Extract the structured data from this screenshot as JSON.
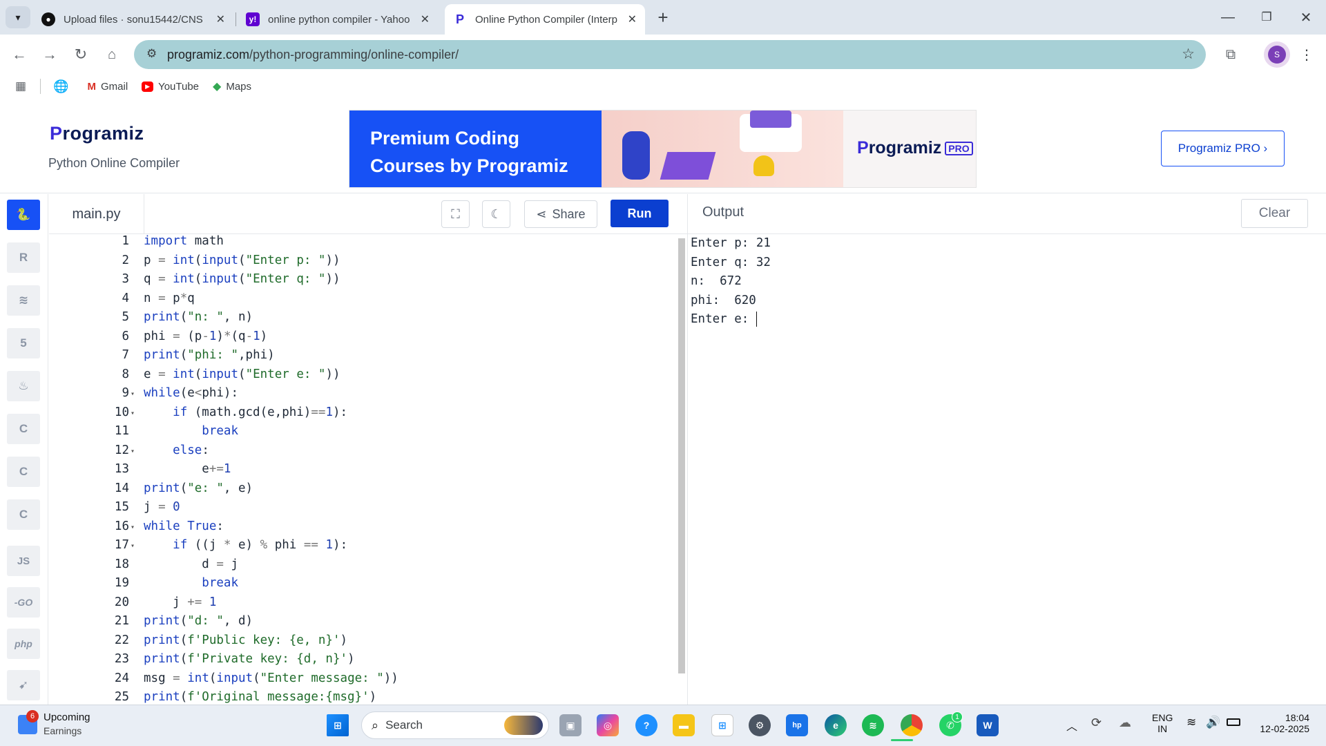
{
  "tabs": [
    {
      "title": "Upload files · sonu15442/CNS",
      "icon": "github-icon"
    },
    {
      "title": "online python compiler - Yahoo",
      "icon": "yahoo-icon"
    },
    {
      "title": "Online Python Compiler (Interp",
      "icon": "programiz-icon"
    }
  ],
  "omnibox": {
    "host": "programiz.com",
    "path": "/python-programming/online-compiler/"
  },
  "profile_initial": "S",
  "bookmarks": [
    "Gmail",
    "YouTube",
    "Maps"
  ],
  "header": {
    "logo": "rogramiz",
    "logo_p": "P",
    "subtitle": "Python Online Compiler",
    "banner_line1": "Premium Coding",
    "banner_line2": "Courses by Programiz",
    "banner_brand": "rogramiz",
    "banner_brand_p": "P",
    "banner_badge": "PRO",
    "pro_button": "Programiz PRO ›"
  },
  "rail": [
    "py",
    "R",
    "db",
    "5",
    "java",
    "C",
    "C++",
    "C#",
    "JS",
    "-GO",
    "php",
    "swift"
  ],
  "editor": {
    "filename": "main.py",
    "share": "Share",
    "run": "Run",
    "lines": [
      {
        "n": "1",
        "fold": false,
        "code": "import math"
      },
      {
        "n": "2",
        "fold": false,
        "code": "p = int(input(\"Enter p: \"))"
      },
      {
        "n": "3",
        "fold": false,
        "code": "q = int(input(\"Enter q: \"))"
      },
      {
        "n": "4",
        "fold": false,
        "code": "n = p*q"
      },
      {
        "n": "5",
        "fold": false,
        "code": "print(\"n: \", n)"
      },
      {
        "n": "6",
        "fold": false,
        "code": "phi = (p-1)*(q-1)"
      },
      {
        "n": "7",
        "fold": false,
        "code": "print(\"phi: \",phi)"
      },
      {
        "n": "8",
        "fold": false,
        "code": "e = int(input(\"Enter e: \"))"
      },
      {
        "n": "9",
        "fold": true,
        "code": "while(e<phi):"
      },
      {
        "n": "10",
        "fold": true,
        "code": "    if (math.gcd(e,phi)==1):"
      },
      {
        "n": "11",
        "fold": false,
        "code": "        break"
      },
      {
        "n": "12",
        "fold": true,
        "code": "    else:"
      },
      {
        "n": "13",
        "fold": false,
        "code": "        e+=1"
      },
      {
        "n": "14",
        "fold": false,
        "code": "print(\"e: \", e)"
      },
      {
        "n": "15",
        "fold": false,
        "code": "j = 0"
      },
      {
        "n": "16",
        "fold": true,
        "code": "while True:"
      },
      {
        "n": "17",
        "fold": true,
        "code": "    if ((j * e) % phi == 1):"
      },
      {
        "n": "18",
        "fold": false,
        "code": "        d = j"
      },
      {
        "n": "19",
        "fold": false,
        "code": "        break"
      },
      {
        "n": "20",
        "fold": false,
        "code": "    j += 1"
      },
      {
        "n": "21",
        "fold": false,
        "code": "print(\"d: \", d)"
      },
      {
        "n": "22",
        "fold": false,
        "code": "print(f'Public key: {e, n}')"
      },
      {
        "n": "23",
        "fold": false,
        "code": "print(f'Private key: {d, n}')"
      },
      {
        "n": "24",
        "fold": false,
        "code": "msg = int(input(\"Enter message: \"))"
      },
      {
        "n": "25",
        "fold": false,
        "code": "print(f'Original message:{msg}')"
      }
    ]
  },
  "output": {
    "title": "Output",
    "clear": "Clear",
    "lines": [
      "Enter p: 21",
      "Enter q: 32",
      "n:  672",
      "phi:  620",
      "Enter e: "
    ]
  },
  "taskbar": {
    "weather_badge": "6",
    "weather_title": "Upcoming",
    "weather_sub": "Earnings",
    "search": "Search",
    "whatsapp_badge": "1",
    "lang1": "ENG",
    "lang2": "IN",
    "time": "18:04",
    "date": "12-02-2025"
  },
  "colors": {
    "accent": "#0b3fd0",
    "omnibox": "#a7d0d6",
    "brand": "#1751f5"
  }
}
